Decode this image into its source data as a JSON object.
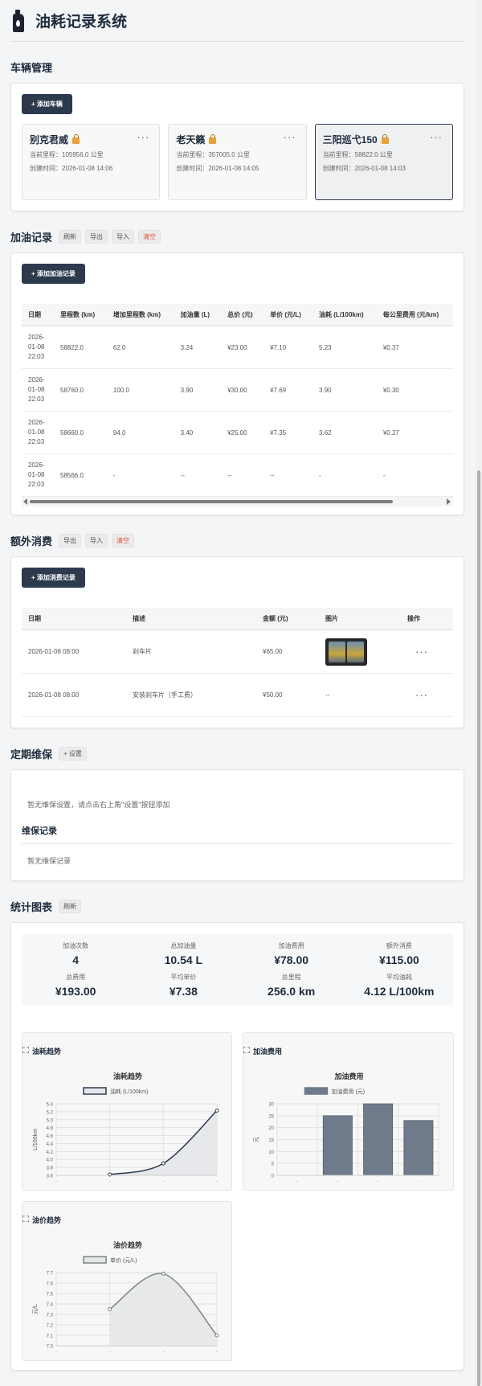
{
  "app": {
    "title": "油耗记录系统"
  },
  "vehicles_section": {
    "title": "车辆管理",
    "add_label": "+ 添加车辆",
    "items": [
      {
        "name": "别克君威",
        "mileage": "当前里程：105956.0 公里",
        "created": "创建时间：2026-01-08 14:06",
        "active": false
      },
      {
        "name": "老天籁",
        "mileage": "当前里程：357005.0 公里",
        "created": "创建时间：2026-01-08 14:05",
        "active": false
      },
      {
        "name": "三阳巡弋150",
        "mileage": "当前里程：58822.0 公里",
        "created": "创建时间：2026-01-08 14:03",
        "active": true
      }
    ]
  },
  "fuel_section": {
    "title": "加油记录",
    "actions": [
      "刷新",
      "导出",
      "导入",
      "清空"
    ],
    "add_label": "+ 添加加油记录",
    "columns": [
      "日期",
      "里程数 (km)",
      "增加里程数 (km)",
      "加油量 (L)",
      "总价 (元)",
      "单价 (元/L)",
      "油耗 (L/100km)",
      "每公里费用 (元/km)"
    ],
    "rows": [
      [
        "2026-01-08 22:03",
        "58822.0",
        "62.0",
        "3.24",
        "¥23.00",
        "¥7.10",
        "5.23",
        "¥0.37"
      ],
      [
        "2026-01-08 22:03",
        "58760.0",
        "100.0",
        "3.90",
        "¥30.00",
        "¥7.69",
        "3.90",
        "¥0.30"
      ],
      [
        "2026-01-08 22:03",
        "58660.0",
        "94.0",
        "3.40",
        "¥25.00",
        "¥7.35",
        "3.62",
        "¥0.27"
      ],
      [
        "2026-01-08 22:03",
        "58566.0",
        "-",
        "--",
        "--",
        "--",
        "-",
        "-"
      ]
    ]
  },
  "extra_section": {
    "title": "额外消费",
    "actions": [
      "导出",
      "导入",
      "清空"
    ],
    "add_label": "+ 添加消费记录",
    "columns": [
      "日期",
      "描述",
      "金额 (元)",
      "图片",
      "操作"
    ],
    "rows": [
      {
        "date": "2026-01-08 08:00",
        "desc": "刹车片",
        "amount": "¥65.00",
        "image": true,
        "op": "···"
      },
      {
        "date": "2026-01-08 08:00",
        "desc": "安装刹车片（手工费）",
        "amount": "¥50.00",
        "image": false,
        "image_text": "--",
        "op": "···"
      }
    ]
  },
  "maintenance_section": {
    "title": "定期维保",
    "settings_label": "+ 设置",
    "empty_text": "暂无维保设置，请点击右上角\"设置\"按钮添加",
    "records_title": "维保记录",
    "records_empty": "暂无维保记录"
  },
  "stats_section": {
    "title": "统计图表",
    "refresh_label": "刷新",
    "stats": [
      {
        "label": "加油次数",
        "value": "4"
      },
      {
        "label": "总加油量",
        "value": "10.54 L"
      },
      {
        "label": "加油费用",
        "value": "¥78.00"
      },
      {
        "label": "额外消费",
        "value": "¥115.00"
      },
      {
        "label": "总费用",
        "value": "¥193.00"
      },
      {
        "label": "平均单价",
        "value": "¥7.38"
      },
      {
        "label": "总里程",
        "value": "256.0 km"
      },
      {
        "label": "平均油耗",
        "value": "4.12 L/100km"
      }
    ]
  },
  "chart_data": [
    {
      "type": "line",
      "card_title": "油耗趋势",
      "title": "油耗趋势",
      "ylabel": "L/100km",
      "ylim": [
        3.6,
        5.4
      ],
      "yticks": [
        "3.6",
        "3.8",
        "4.0",
        "4.2",
        "4.4",
        "4.6",
        "4.8",
        "5.0",
        "5.2",
        "5.4"
      ],
      "x": [
        "-",
        "-",
        "-",
        "-"
      ],
      "series": [
        {
          "name": "油耗 (L/100km)",
          "values": [
            null,
            3.62,
            3.9,
            5.23
          ]
        }
      ],
      "color": "#2d3a4e",
      "fill": "#e4e6ea"
    },
    {
      "type": "bar",
      "card_title": "加油费用",
      "title": "加油费用",
      "ylabel": "元",
      "ylim": [
        0,
        30
      ],
      "yticks": [
        "0",
        "5",
        "10",
        "15",
        "20",
        "25",
        "30"
      ],
      "categories": [
        "-",
        "-",
        "-",
        "-"
      ],
      "series": [
        {
          "name": "加油费用 (元)",
          "values": [
            0,
            25,
            30,
            23
          ]
        }
      ],
      "color": "#6f7b8b"
    },
    {
      "type": "line",
      "card_title": "油价趋势",
      "title": "油价趋势",
      "ylabel": "元/L",
      "ylim": [
        7.0,
        7.7
      ],
      "yticks": [
        "7.0",
        "7.1",
        "7.2",
        "7.3",
        "7.4",
        "7.5",
        "7.6",
        "7.7"
      ],
      "x": [
        "-",
        "-",
        "-",
        "-"
      ],
      "series": [
        {
          "name": "单价 (元/L)",
          "values": [
            null,
            7.35,
            7.69,
            7.1
          ]
        }
      ],
      "color": "#7b8580",
      "fill": "#e6e8e6"
    }
  ]
}
